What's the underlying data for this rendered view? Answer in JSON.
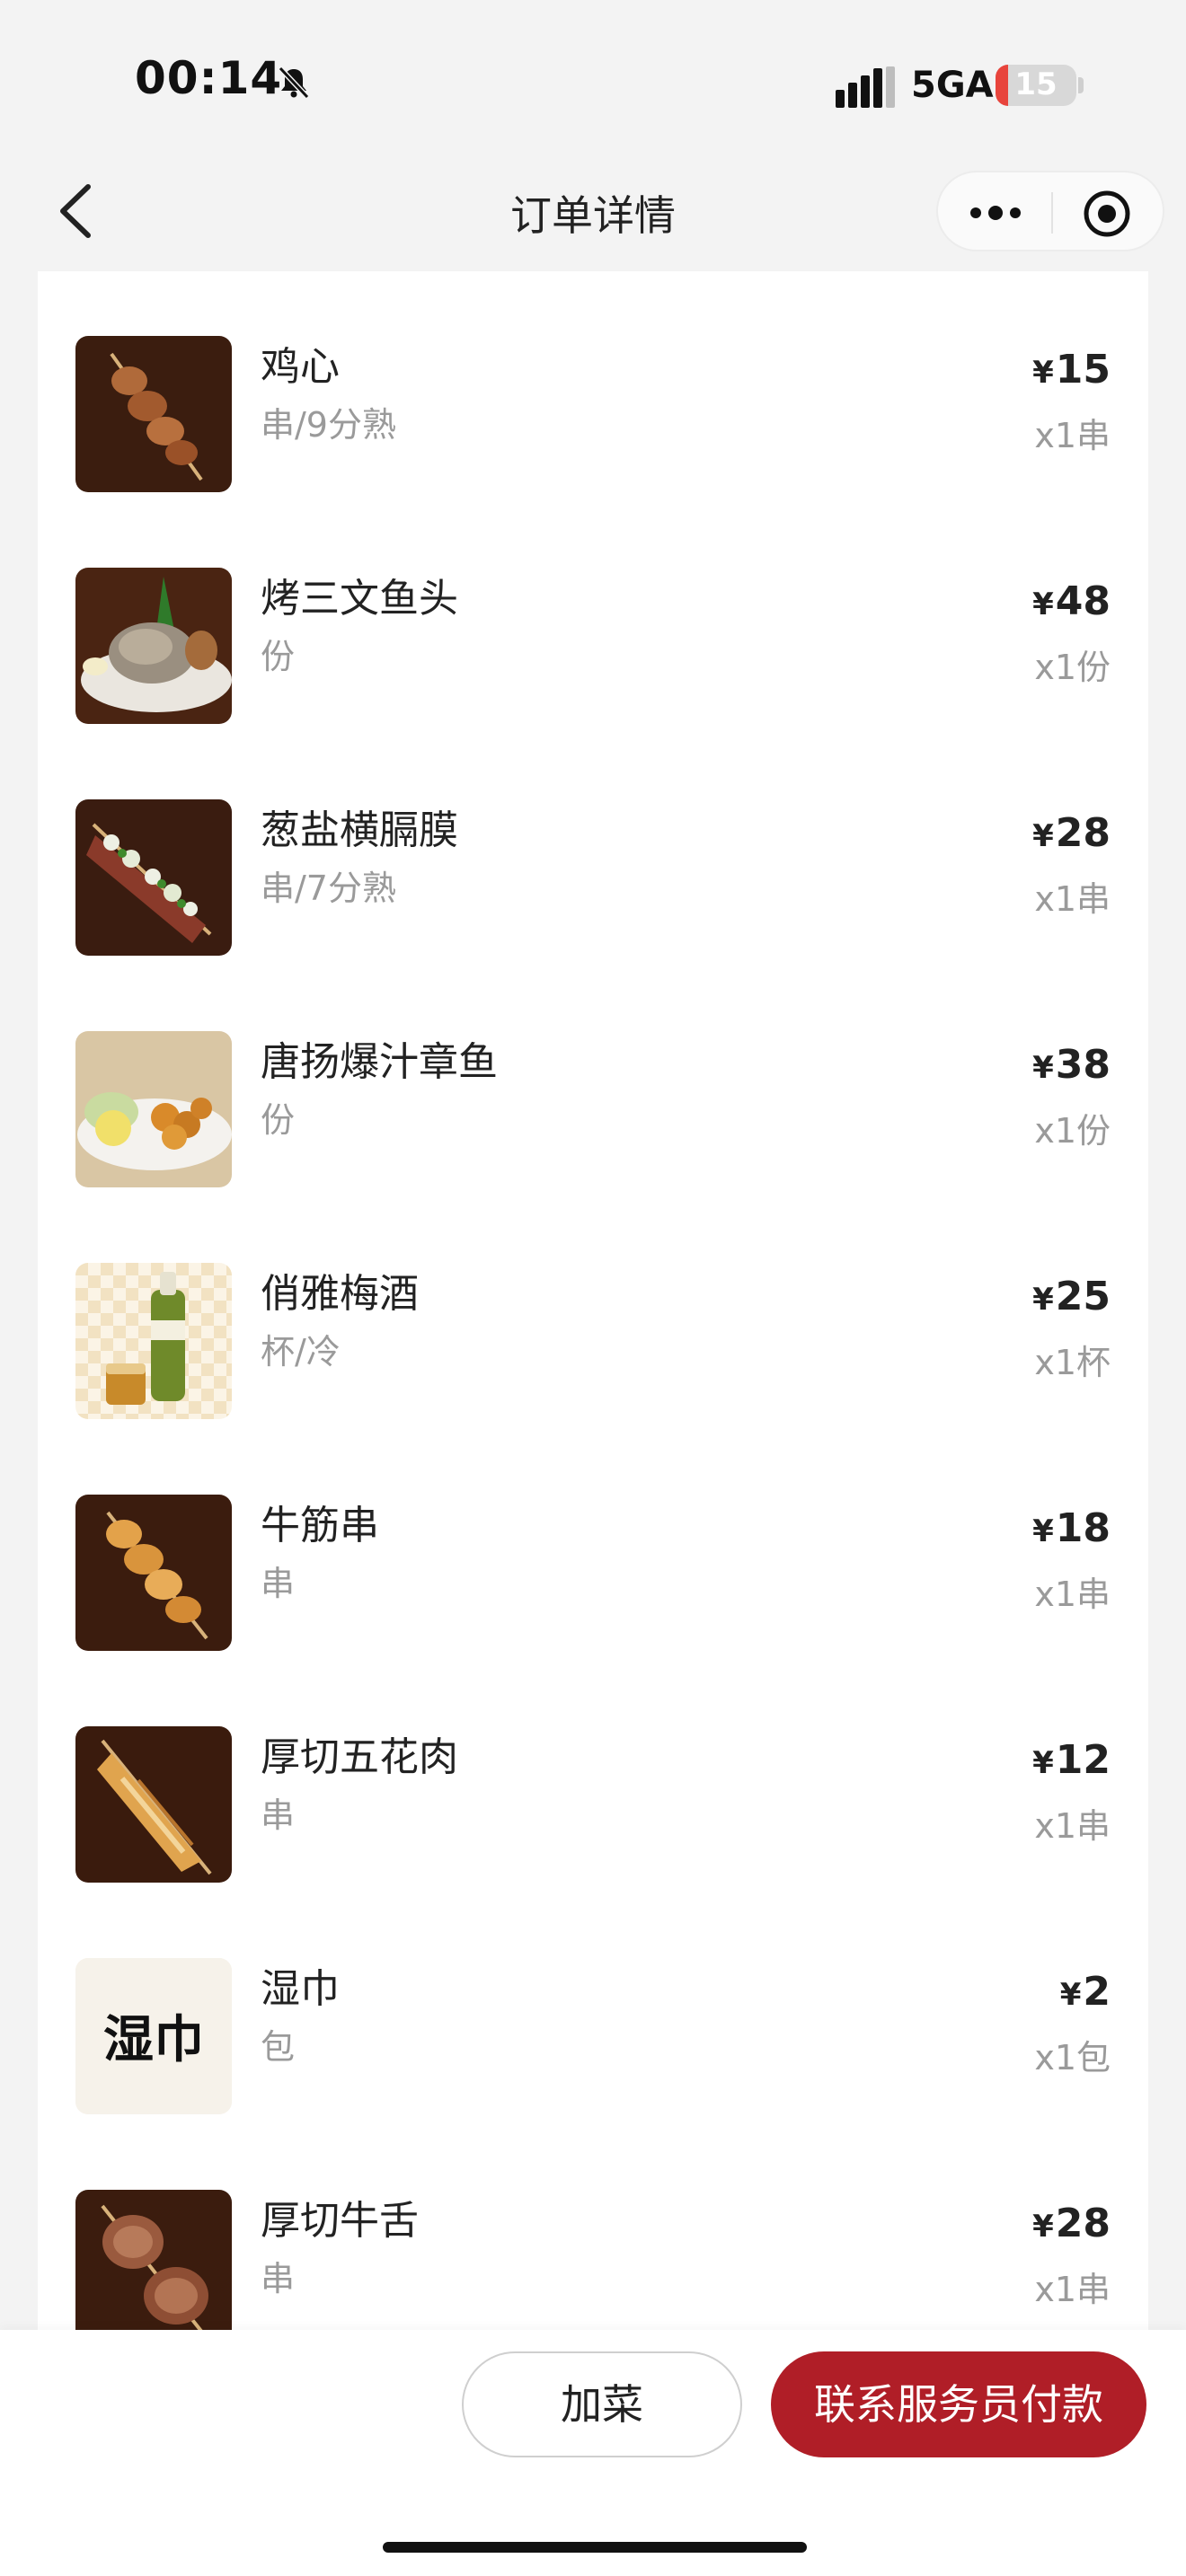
{
  "status_bar": {
    "time": "00:14",
    "network": "5GA",
    "battery_level": "15",
    "battery_fraction": 0.15
  },
  "nav": {
    "title": "订单详情"
  },
  "colors": {
    "accent": "#b01e27",
    "battery_low": "#e8443c"
  },
  "order_items": [
    {
      "name": "鸡心",
      "spec": "串/9分熟",
      "currency": "¥",
      "price": "15",
      "qty": "x1串",
      "image": "skewer-chicken-heart"
    },
    {
      "name": "烤三文鱼头",
      "spec": "份",
      "currency": "¥",
      "price": "48",
      "qty": "x1份",
      "image": "grilled-salmon-head"
    },
    {
      "name": "葱盐横膈膜",
      "spec": "串/7分熟",
      "currency": "¥",
      "price": "28",
      "qty": "x1串",
      "image": "skewer-green-onion-beef"
    },
    {
      "name": "唐扬爆汁章鱼",
      "spec": "份",
      "currency": "¥",
      "price": "38",
      "qty": "x1份",
      "image": "fried-octopus-plate"
    },
    {
      "name": "俏雅梅酒",
      "spec": "杯/冷",
      "currency": "¥",
      "price": "25",
      "qty": "x1杯",
      "image": "plum-wine-bottle"
    },
    {
      "name": "牛筋串",
      "spec": "串",
      "currency": "¥",
      "price": "18",
      "qty": "x1串",
      "image": "skewer-beef-tendon"
    },
    {
      "name": "厚切五花肉",
      "spec": "串",
      "currency": "¥",
      "price": "12",
      "qty": "x1串",
      "image": "skewer-pork-belly"
    },
    {
      "name": "湿巾",
      "spec": "包",
      "currency": "¥",
      "price": "2",
      "qty": "x1包",
      "image": "wet-towel-text",
      "image_text": "湿巾"
    },
    {
      "name": "厚切牛舌",
      "spec": "串",
      "currency": "¥",
      "price": "28",
      "qty": "x1串",
      "image": "skewer-beef-tongue"
    }
  ],
  "bottom_bar": {
    "add_label": "加菜",
    "pay_label": "联系服务员付款"
  }
}
